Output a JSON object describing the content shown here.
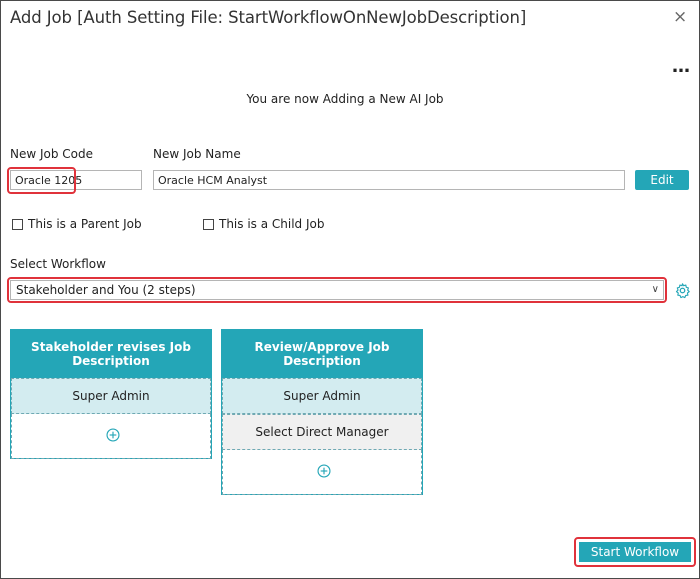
{
  "dialog": {
    "title": "Add Job [Auth Setting File: StartWorkflowOnNewJobDescription]",
    "close_icon": "close-icon",
    "menu_icon": "more-horizontal-icon",
    "menu_glyph": "…",
    "close_glyph": "×"
  },
  "subtitle": "You are now Adding a New AI Job",
  "form": {
    "job_code_label": "New Job Code",
    "job_code_value": "Oracle 1205",
    "job_name_label": "New Job Name",
    "job_name_value": "Oracle HCM Analyst",
    "edit_label": "Edit",
    "parent_job_label": "This is a Parent Job",
    "parent_job_checked": false,
    "child_job_label": "This is a Child Job",
    "child_job_checked": false,
    "workflow_label": "Select Workflow",
    "workflow_value": "Stakeholder and You (2 steps)",
    "workflow_chevron": "∨"
  },
  "workflow_cards": [
    {
      "title": "Stakeholder revises Job Description",
      "steps": [
        "Super Admin"
      ]
    },
    {
      "title": "Review/Approve Job Description",
      "steps": [
        "Super Admin",
        "Select Direct Manager"
      ]
    }
  ],
  "footer": {
    "start_label": "Start Workflow"
  },
  "colors": {
    "accent": "#24a6b7",
    "highlight": "#e0323b",
    "step_bg": "#d3ecf0"
  }
}
